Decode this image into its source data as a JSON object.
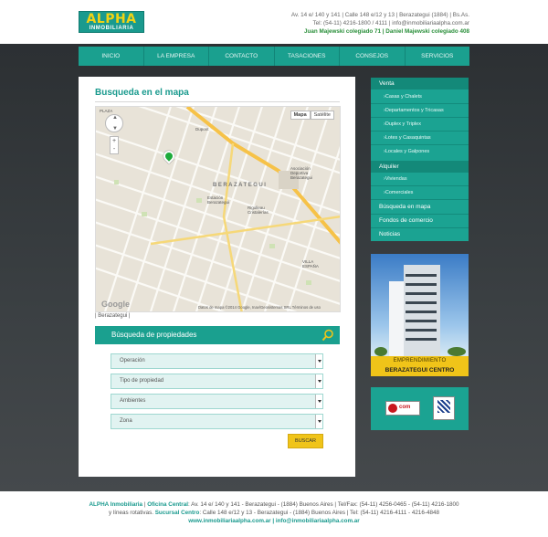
{
  "header": {
    "logo_main": "ALPHA",
    "logo_sub": "INMOBILIARIA",
    "address_line": "Av. 14 e/ 140 y 141 | Calle 148 e/12 y 13 | Berazategui (1884) | Bs.As.",
    "contact_line": "Tel: (54-11) 4216-1800 / 4111 | info@inmobiliariaalpha.com.ar",
    "licenses_line": "Juan Majewski colegiado 71 | Daniel Majewski colegiado 408"
  },
  "nav": {
    "items": [
      "INICIO",
      "LA EMPRESA",
      "CONTACTO",
      "TASACIONES",
      "CONSEJOS",
      "SERVICIOS"
    ]
  },
  "main": {
    "title": "Busqueda en el mapa",
    "map_caption": "| Berazategui |",
    "map": {
      "btn_map": "Mapa",
      "btn_sat": "Satélite",
      "credit": "Datos de mapa ©2014 Google, Inav/Geosistemas SRL   Términos de uso",
      "google": "Google",
      "labels": {
        "city": "BERAZATEGUI",
        "dupont": "Dupont",
        "estacion": "Estación Berazategui",
        "asoc": "Asociación Deportiva Berazategui",
        "rigolleau": "Rigolleau Cristalerías",
        "villa": "VILLA ESPAÑA",
        "plaza": "PLAZA"
      },
      "zoom_in": "+",
      "zoom_out": "-"
    }
  },
  "search": {
    "title": "Búsqueda de propiedades",
    "fields": [
      "Operación",
      "Tipo de propiedad",
      "Ambientes",
      "Zona"
    ],
    "button": "BUSCAR"
  },
  "sidebar": {
    "venta": "Venta",
    "venta_items": [
      "Casas y Chalets",
      "Departamentos y Tricasas",
      "Duplex y Triplex",
      "Lotes y Casaquintas",
      "Locales y Galpones"
    ],
    "alquiler": "Alquiler",
    "alquiler_items": [
      "Viviendas",
      "Comerciales"
    ],
    "other_items": [
      "Búsqueda en mapa",
      "Fondos de comercio",
      "Noticias"
    ]
  },
  "promo": {
    "caption1": "EMPRENDIMIENTO",
    "caption2": "BERAZATEGUI CENTRO"
  },
  "partners": {
    "a": "com"
  },
  "footer": {
    "line1_brand": "ALPHA Inmobiliaria",
    "line1_label": "Oficina Central",
    "line1_text": "Av. 14  e/ 140 y 141 - Berazategui - (1884) Buenos Aires | Tel/Fax: (54-11) 4256-0465 - (54-11) 4216-1800",
    "line2_pre": "y líneas rotativas.",
    "line2_label": "Sucursal Centro",
    "line2_text": "Calle 148 e/12 y 13 - Berazategui - (1884) Buenos Aires | Tel: (54-11) 4216-4111 - 4216-4848",
    "line3": "www.inmobiliariaalpha.com.ar | info@inmobiliariaalpha.com.ar"
  }
}
